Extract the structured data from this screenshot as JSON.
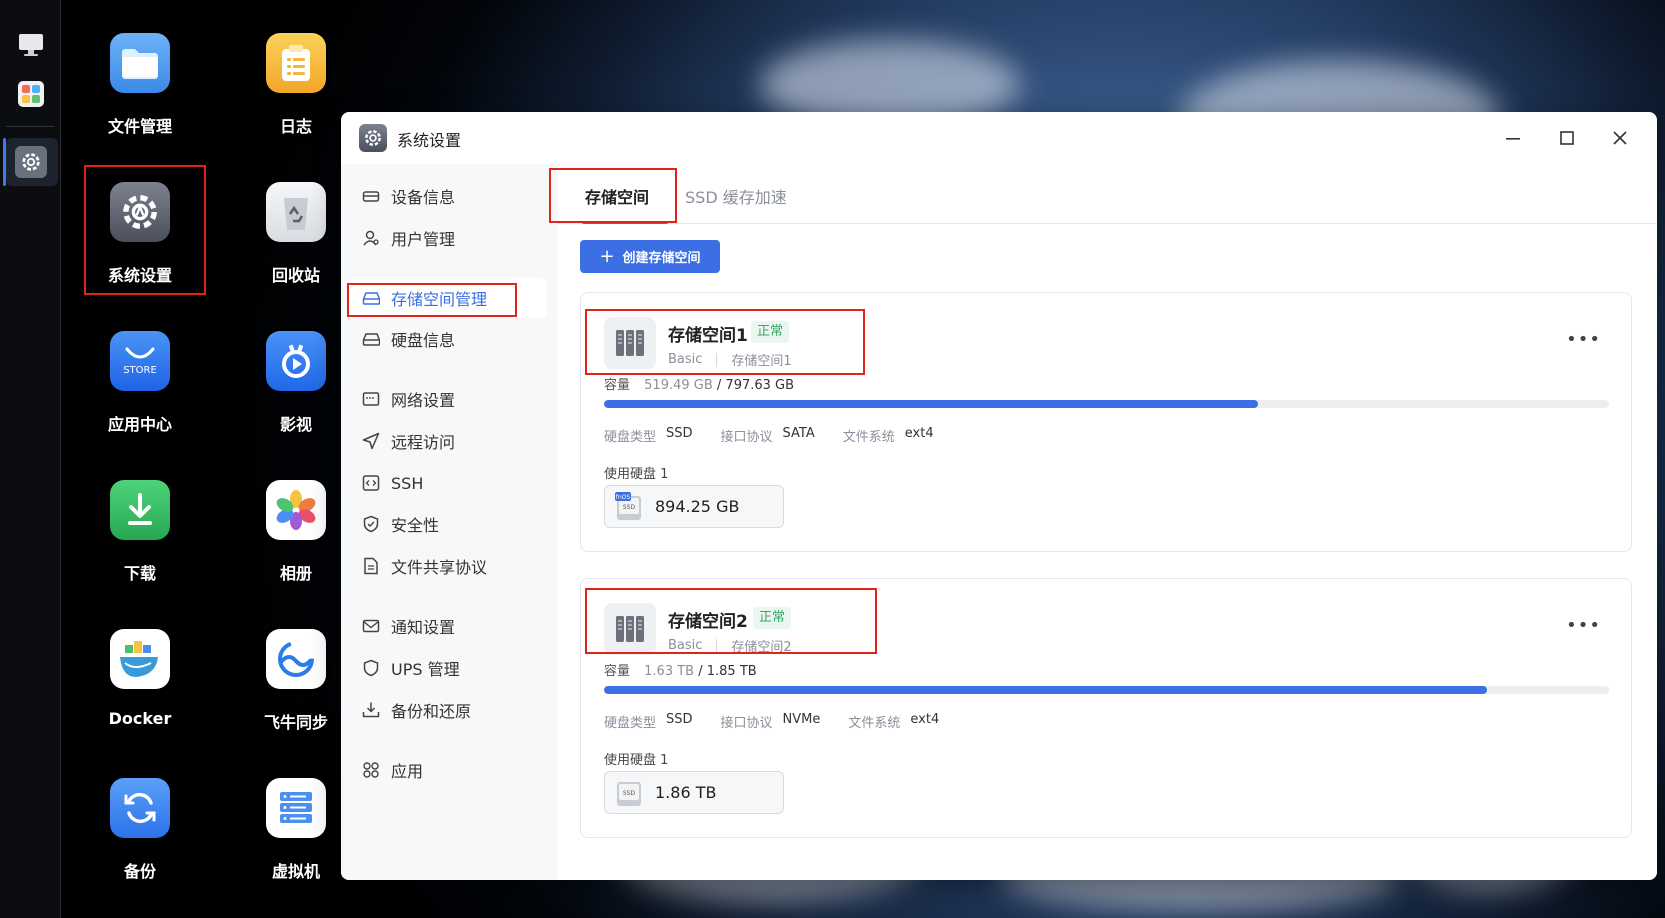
{
  "desktop": {
    "icons": [
      {
        "label": "文件管理",
        "icon": "folder-icon",
        "color": "#4a9bf0"
      },
      {
        "label": "日志",
        "icon": "notepad-icon",
        "color": "#f6b73c"
      },
      {
        "label": "系统设置",
        "icon": "gear-icon",
        "color": "#5b606c"
      },
      {
        "label": "回收站",
        "icon": "recycle-bin-icon",
        "color": "#e9ebef"
      },
      {
        "label": "应用中心",
        "icon": "store-icon",
        "color": "#2f7bf0"
      },
      {
        "label": "影视",
        "icon": "video-icon",
        "color": "#2e7ef5"
      },
      {
        "label": "下载",
        "icon": "download-icon",
        "color": "#36c066"
      },
      {
        "label": "相册",
        "icon": "photos-icon",
        "color": "#ffffff"
      },
      {
        "label": "Docker",
        "icon": "docker-icon",
        "color": "#ffffff"
      },
      {
        "label": "飞牛同步",
        "icon": "sync-icon",
        "color": "#ffffff"
      },
      {
        "label": "备份",
        "icon": "backup-icon",
        "color": "#3a86f2"
      },
      {
        "label": "虚拟机",
        "icon": "vm-icon",
        "color": "#ffffff"
      }
    ],
    "store_tile_text": "STORE"
  },
  "window": {
    "title": "系统设置",
    "sidebar": [
      {
        "label": "设备信息",
        "icon": "device-icon"
      },
      {
        "label": "用户管理",
        "icon": "user-icon"
      },
      {
        "label": "存储空间管理",
        "icon": "storage-icon",
        "active": true
      },
      {
        "label": "硬盘信息",
        "icon": "disk-icon"
      },
      {
        "label": "网络设置",
        "icon": "network-icon"
      },
      {
        "label": "远程访问",
        "icon": "send-icon"
      },
      {
        "label": "SSH",
        "icon": "code-icon"
      },
      {
        "label": "安全性",
        "icon": "shield-check-icon"
      },
      {
        "label": "文件共享协议",
        "icon": "file-icon"
      },
      {
        "label": "通知设置",
        "icon": "mail-icon"
      },
      {
        "label": "UPS 管理",
        "icon": "shield-icon"
      },
      {
        "label": "备份和还原",
        "icon": "backup-restore-icon"
      },
      {
        "label": "应用",
        "icon": "apps-icon"
      }
    ],
    "tabs": [
      {
        "label": "存储空间",
        "active": true
      },
      {
        "label": "SSD 缓存加速",
        "active": false
      }
    ],
    "create_button": "创建存储空间",
    "pools": [
      {
        "name": "存储空间1",
        "status": "正常",
        "raid": "Basic",
        "subname": "存储空间1",
        "capacity_label": "容量",
        "used": "519.49 GB",
        "total": "/ 797.63 GB",
        "usage_fraction": 0.651,
        "disk_type_label": "硬盘类型",
        "disk_type": "SSD",
        "interface_label": "接口协议",
        "interface": "SATA",
        "fs_label": "文件系统",
        "fs": "ext4",
        "disks_label": "使用硬盘 1",
        "disk_size": "894.25 GB",
        "disk_badge": "fnOS",
        "disk_badge_sub": "SSD"
      },
      {
        "name": "存储空间2",
        "status": "正常",
        "raid": "Basic",
        "subname": "存储空间2",
        "capacity_label": "容量",
        "used": "1.63 TB",
        "total": "/ 1.85 TB",
        "usage_fraction": 0.879,
        "disk_type_label": "硬盘类型",
        "disk_type": "SSD",
        "interface_label": "接口协议",
        "interface": "NVMe",
        "fs_label": "文件系统",
        "fs": "ext4",
        "disks_label": "使用硬盘 1",
        "disk_size": "1.86 TB",
        "disk_badge_sub": "SSD"
      }
    ]
  },
  "colors": {
    "accent": "#3d6fe4",
    "highlight_box": "#e2231a",
    "status_ok": "#3ca468"
  }
}
